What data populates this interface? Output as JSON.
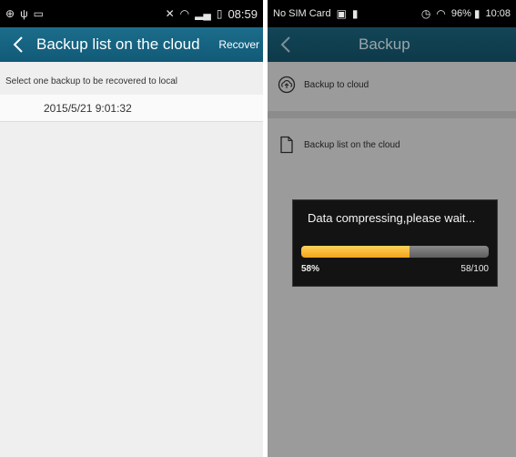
{
  "left": {
    "status": {
      "icons": [
        "settings-icon",
        "usb-icon",
        "screenshot-icon",
        "mute-icon",
        "wifi-icon",
        "signal-icon",
        "battery-icon"
      ],
      "time": "08:59"
    },
    "title": "Backup list on the cloud",
    "recover_label": "Recover",
    "instruction": "Select one backup to be recovered to local",
    "backups": [
      "2015/5/21 9:01:32"
    ]
  },
  "right": {
    "status": {
      "carrier": "No SIM Card",
      "battery": "96%",
      "time": "10:08"
    },
    "title": "Backup",
    "menu": [
      {
        "label": "Backup to cloud",
        "icon": "cloud-upload-icon"
      },
      {
        "label": "Backup list on the cloud",
        "icon": "document-icon"
      }
    ],
    "dialog": {
      "message": "Data compressing,please wait...",
      "percent_label": "58%",
      "count_label": "58/100",
      "progress": 0.58
    }
  },
  "colors": {
    "titlebar": "#1b6d8b",
    "progress": "#f3a51a",
    "overlay": "#9b9b9b"
  }
}
